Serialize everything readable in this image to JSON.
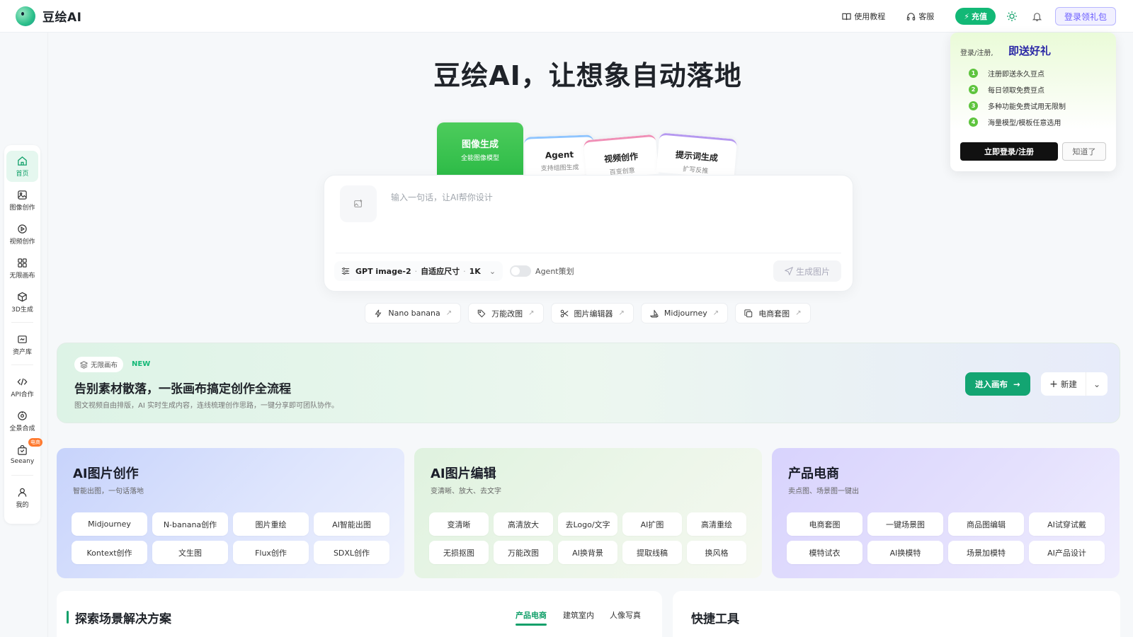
{
  "header": {
    "brand": "豆绘AI",
    "tutorial": "使用教程",
    "service": "客服",
    "charge": "充值",
    "gift_button": "登录领礼包"
  },
  "sidebar": {
    "items": [
      {
        "label": "首页",
        "icon": "home-icon"
      },
      {
        "label": "图像创作",
        "icon": "image-icon"
      },
      {
        "label": "视频创作",
        "icon": "play-icon"
      },
      {
        "label": "无限画布",
        "icon": "grid-icon"
      },
      {
        "label": "3D生成",
        "icon": "cube-icon"
      },
      {
        "label": "资产库",
        "icon": "folder-icon"
      },
      {
        "label": "API合作",
        "icon": "code-icon"
      },
      {
        "label": "全景合成",
        "icon": "panorama-icon"
      },
      {
        "label": "Seeany",
        "icon": "bag-icon",
        "badge": "电商"
      },
      {
        "label": "我的",
        "icon": "user-icon"
      }
    ]
  },
  "hero": {
    "title": "豆绘AI，让想象自动落地"
  },
  "mode_tabs": [
    {
      "title": "图像生成",
      "sub": "全能图像模型"
    },
    {
      "title": "Agent",
      "sub": "支持组图生成"
    },
    {
      "title": "视频创作",
      "sub": "百变创意"
    },
    {
      "title": "提示词生成",
      "sub": "扩写反推"
    }
  ],
  "prompt": {
    "placeholder": "输入一句话，让AI帮你设计",
    "model": "GPT image-2",
    "size": "自适应尺寸",
    "resolution": "1K",
    "agent_label": "Agent策划",
    "generate": "生成图片"
  },
  "quick_chips": [
    {
      "label": "Nano banana",
      "icon": "bolt-icon"
    },
    {
      "label": "万能改图",
      "icon": "tag-icon"
    },
    {
      "label": "图片编辑器",
      "icon": "scissors-icon"
    },
    {
      "label": "Midjourney",
      "icon": "boat-icon"
    },
    {
      "label": "电商套图",
      "icon": "copy-icon"
    }
  ],
  "banner": {
    "pill": "无限画布",
    "new_tag": "NEW",
    "title": "告别素材散落，一张画布搞定创作全流程",
    "subtitle": "图文视频自由排版，AI 实时生成内容，连线梳理创作思路，一键分享即可团队协作。",
    "enter": "进入画布",
    "new": "新建"
  },
  "cards": [
    {
      "title": "AI图片创作",
      "subtitle": "智能出图，一句话落地",
      "buttons": [
        "Midjourney",
        "N-banana创作",
        "图片重绘",
        "AI智能出图",
        "Kontext创作",
        "文生图",
        "Flux创作",
        "SDXL创作"
      ]
    },
    {
      "title": "AI图片编辑",
      "subtitle": "变清晰、放大、去文字",
      "buttons": [
        "变清晰",
        "高清放大",
        "去Logo/文字",
        "AI扩图",
        "高清重绘",
        "无损抠图",
        "万能改图",
        "AI换背景",
        "提取线稿",
        "换风格"
      ]
    },
    {
      "title": "产品电商",
      "subtitle": "卖点图、场景图一键出",
      "buttons": [
        "电商套图",
        "一键场景图",
        "商品图编辑",
        "AI试穿试戴",
        "模特试衣",
        "AI换模特",
        "场景加模特",
        "AI产品设计"
      ]
    }
  ],
  "scenes": {
    "title": "探索场景解决方案",
    "tabs": [
      "产品电商",
      "建筑室内",
      "人像写真"
    ]
  },
  "tools": {
    "title": "快捷工具"
  },
  "gift_panel": {
    "prefix": "登录/注册,",
    "headline": "即送好礼",
    "items": [
      "注册即送永久豆点",
      "每日领取免费豆点",
      "多种功能免费试用无限制",
      "海量模型/模板任意选用"
    ],
    "login": "立即登录/注册",
    "dismiss": "知道了"
  },
  "colors": {
    "brand_green": "#12b876",
    "enter_green": "#13a572",
    "gift_purple": "#6a5cff"
  }
}
